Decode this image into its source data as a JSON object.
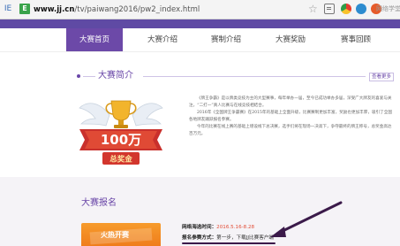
{
  "browser": {
    "ie_label": "IE",
    "site_badge": "E",
    "url_domain": "www.jj.cn",
    "url_path": "/tv/paiwang2016/pw2_index.html",
    "extension_label": "网络学堂"
  },
  "nav": {
    "items": [
      {
        "label": "大赛首页",
        "active": true
      },
      {
        "label": "大赛介绍",
        "active": false
      },
      {
        "label": "赛制介绍",
        "active": false
      },
      {
        "label": "大赛奖励",
        "active": false
      },
      {
        "label": "赛事回顾",
        "active": false
      }
    ]
  },
  "intro": {
    "title": "大赛简介",
    "more": "查看更多",
    "medal_amount": "100万",
    "medal_caption": "总奖金",
    "paragraphs": [
      "《牌王争霸》是以牌类竞技为主的大型赛事，每年举办一届，至今已成功举办多届，深受广大牌友的喜爱与关注，“二打一”真人比赛与在线竞技相结合。",
      "2016年《全国牌王争霸赛》在2015年的基础上全面升级，比赛赛制更加丰富，奖励也更加丰厚，吸引了全国各地牌友踊跃报名参赛。",
      "今年的比赛在线上赛的基础上增设线下总决赛，选手们将在现场一决高下，争夺最终的牌王称号，总奖金高达百万元。"
    ]
  },
  "registration": {
    "title": "大赛报名",
    "promo": "火热开赛",
    "date_label": "网络海选时间：",
    "date_value": "2016.5.16-8.28",
    "method_label": "报名参赛方式：",
    "method_value": "第一步，下载JJ比赛客户端"
  },
  "colors": {
    "brand_purple": "#6c49a8",
    "accent_red": "#e24c36",
    "promo_orange": "#f28a24"
  }
}
